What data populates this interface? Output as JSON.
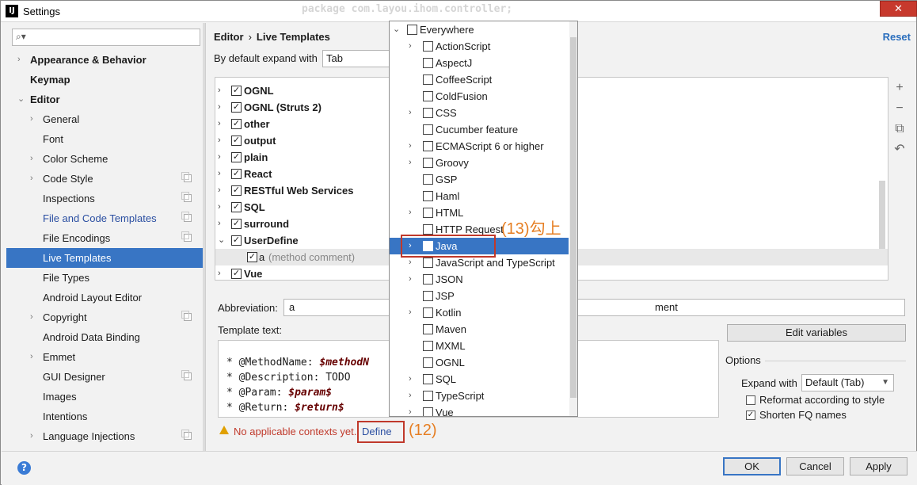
{
  "window": {
    "title": "Settings",
    "app_icon": "IJ",
    "ghost_code": "package com.layou.ihom.controller;",
    "close_symbol": "✕"
  },
  "sidebar": {
    "search_placeholder": "",
    "items": [
      {
        "label": "Appearance & Behavior",
        "arrow": "›",
        "indent": 0,
        "bold": true
      },
      {
        "label": "Keymap",
        "arrow": "",
        "indent": 0,
        "bold": true
      },
      {
        "label": "Editor",
        "arrow": "⌄",
        "indent": 0,
        "bold": true
      },
      {
        "label": "General",
        "arrow": "›",
        "indent": 1
      },
      {
        "label": "Font",
        "arrow": "",
        "indent": 1
      },
      {
        "label": "Color Scheme",
        "arrow": "›",
        "indent": 1
      },
      {
        "label": "Code Style",
        "arrow": "›",
        "indent": 1,
        "copy": true
      },
      {
        "label": "Inspections",
        "arrow": "",
        "indent": 1,
        "copy": true
      },
      {
        "label": "File and Code Templates",
        "arrow": "",
        "indent": 1,
        "copy": true,
        "link": true
      },
      {
        "label": "File Encodings",
        "arrow": "",
        "indent": 1,
        "copy": true
      },
      {
        "label": "Live Templates",
        "arrow": "",
        "indent": 1,
        "selected": true
      },
      {
        "label": "File Types",
        "arrow": "",
        "indent": 1
      },
      {
        "label": "Android Layout Editor",
        "arrow": "",
        "indent": 1
      },
      {
        "label": "Copyright",
        "arrow": "›",
        "indent": 1,
        "copy": true
      },
      {
        "label": "Android Data Binding",
        "arrow": "",
        "indent": 1
      },
      {
        "label": "Emmet",
        "arrow": "›",
        "indent": 1
      },
      {
        "label": "GUI Designer",
        "arrow": "",
        "indent": 1,
        "copy": true
      },
      {
        "label": "Images",
        "arrow": "",
        "indent": 1
      },
      {
        "label": "Intentions",
        "arrow": "",
        "indent": 1
      },
      {
        "label": "Language Injections",
        "arrow": "›",
        "indent": 1,
        "copy": true
      }
    ]
  },
  "header": {
    "breadcrumb_parent": "Editor",
    "breadcrumb_sep": "›",
    "breadcrumb_current": "Live Templates",
    "reset": "Reset"
  },
  "expand": {
    "label": "By default expand with",
    "value": "Tab"
  },
  "template_groups": [
    {
      "label": "OGNL",
      "arrow": "›",
      "checked": true
    },
    {
      "label": "OGNL (Struts 2)",
      "arrow": "›",
      "checked": true
    },
    {
      "label": "other",
      "arrow": "›",
      "checked": true
    },
    {
      "label": "output",
      "arrow": "›",
      "checked": true
    },
    {
      "label": "plain",
      "arrow": "›",
      "checked": true
    },
    {
      "label": "React",
      "arrow": "›",
      "checked": true
    },
    {
      "label": "RESTful Web Services",
      "arrow": "›",
      "checked": true
    },
    {
      "label": "SQL",
      "arrow": "›",
      "checked": true
    },
    {
      "label": "surround",
      "arrow": "›",
      "checked": true
    },
    {
      "label": "UserDefine",
      "arrow": "⌄",
      "checked": true
    },
    {
      "label": "a",
      "desc": "(method comment)",
      "checked": true,
      "child": true
    },
    {
      "label": "Vue",
      "arrow": "›",
      "checked": true
    }
  ],
  "tools": {
    "add": "+",
    "remove": "−",
    "copy": "⧉",
    "revert": "↶"
  },
  "abbreviation": {
    "label": "Abbreviation:",
    "value": "a",
    "description_tail": "ment"
  },
  "template_text": {
    "label": "Template text:",
    "lines": [
      {
        "prefix": "* @MethodName: ",
        "var": "$methodN"
      },
      {
        "prefix": "* @Description: TODO",
        "var": ""
      },
      {
        "prefix": "* @Param: ",
        "var": "$param$"
      },
      {
        "prefix": "* @Return: ",
        "var": "$return$"
      }
    ]
  },
  "edit_variables": "Edit variables",
  "options": {
    "label": "Options",
    "expand_with_label": "Expand with",
    "expand_with_value": "Default (Tab)",
    "reformat": {
      "label": "Reformat according to style",
      "checked": false
    },
    "shorten": {
      "label": "Shorten FQ names",
      "checked": true
    }
  },
  "warning": {
    "text": "No applicable contexts yet.",
    "define": "Define"
  },
  "annotations": {
    "step12": "(12)",
    "step13": "(13)勾上"
  },
  "buttons": {
    "help": "?",
    "ok": "OK",
    "cancel": "Cancel",
    "apply": "Apply"
  },
  "context_popup": {
    "items": [
      {
        "label": "Everywhere",
        "arrow": "⌄",
        "level": 0
      },
      {
        "label": "ActionScript",
        "arrow": "›",
        "level": 1
      },
      {
        "label": "AspectJ",
        "arrow": "",
        "level": 1
      },
      {
        "label": "CoffeeScript",
        "arrow": "",
        "level": 1
      },
      {
        "label": "ColdFusion",
        "arrow": "",
        "level": 1
      },
      {
        "label": "CSS",
        "arrow": "›",
        "level": 1
      },
      {
        "label": "Cucumber feature",
        "arrow": "",
        "level": 1
      },
      {
        "label": "ECMAScript 6 or higher",
        "arrow": "›",
        "level": 1
      },
      {
        "label": "Groovy",
        "arrow": "›",
        "level": 1
      },
      {
        "label": "GSP",
        "arrow": "",
        "level": 1
      },
      {
        "label": "Haml",
        "arrow": "",
        "level": 1
      },
      {
        "label": "HTML",
        "arrow": "›",
        "level": 1
      },
      {
        "label": "HTTP Request",
        "arrow": "",
        "level": 1
      },
      {
        "label": "Java",
        "arrow": "›",
        "level": 1,
        "selected": true
      },
      {
        "label": "JavaScript and TypeScript",
        "arrow": "›",
        "level": 1
      },
      {
        "label": "JSON",
        "arrow": "›",
        "level": 1
      },
      {
        "label": "JSP",
        "arrow": "",
        "level": 1
      },
      {
        "label": "Kotlin",
        "arrow": "›",
        "level": 1
      },
      {
        "label": "Maven",
        "arrow": "",
        "level": 1
      },
      {
        "label": "MXML",
        "arrow": "",
        "level": 1
      },
      {
        "label": "OGNL",
        "arrow": "",
        "level": 1
      },
      {
        "label": "SQL",
        "arrow": "›",
        "level": 1
      },
      {
        "label": "TypeScript",
        "arrow": "›",
        "level": 1
      },
      {
        "label": "Vue",
        "arrow": "›",
        "level": 1
      }
    ]
  }
}
